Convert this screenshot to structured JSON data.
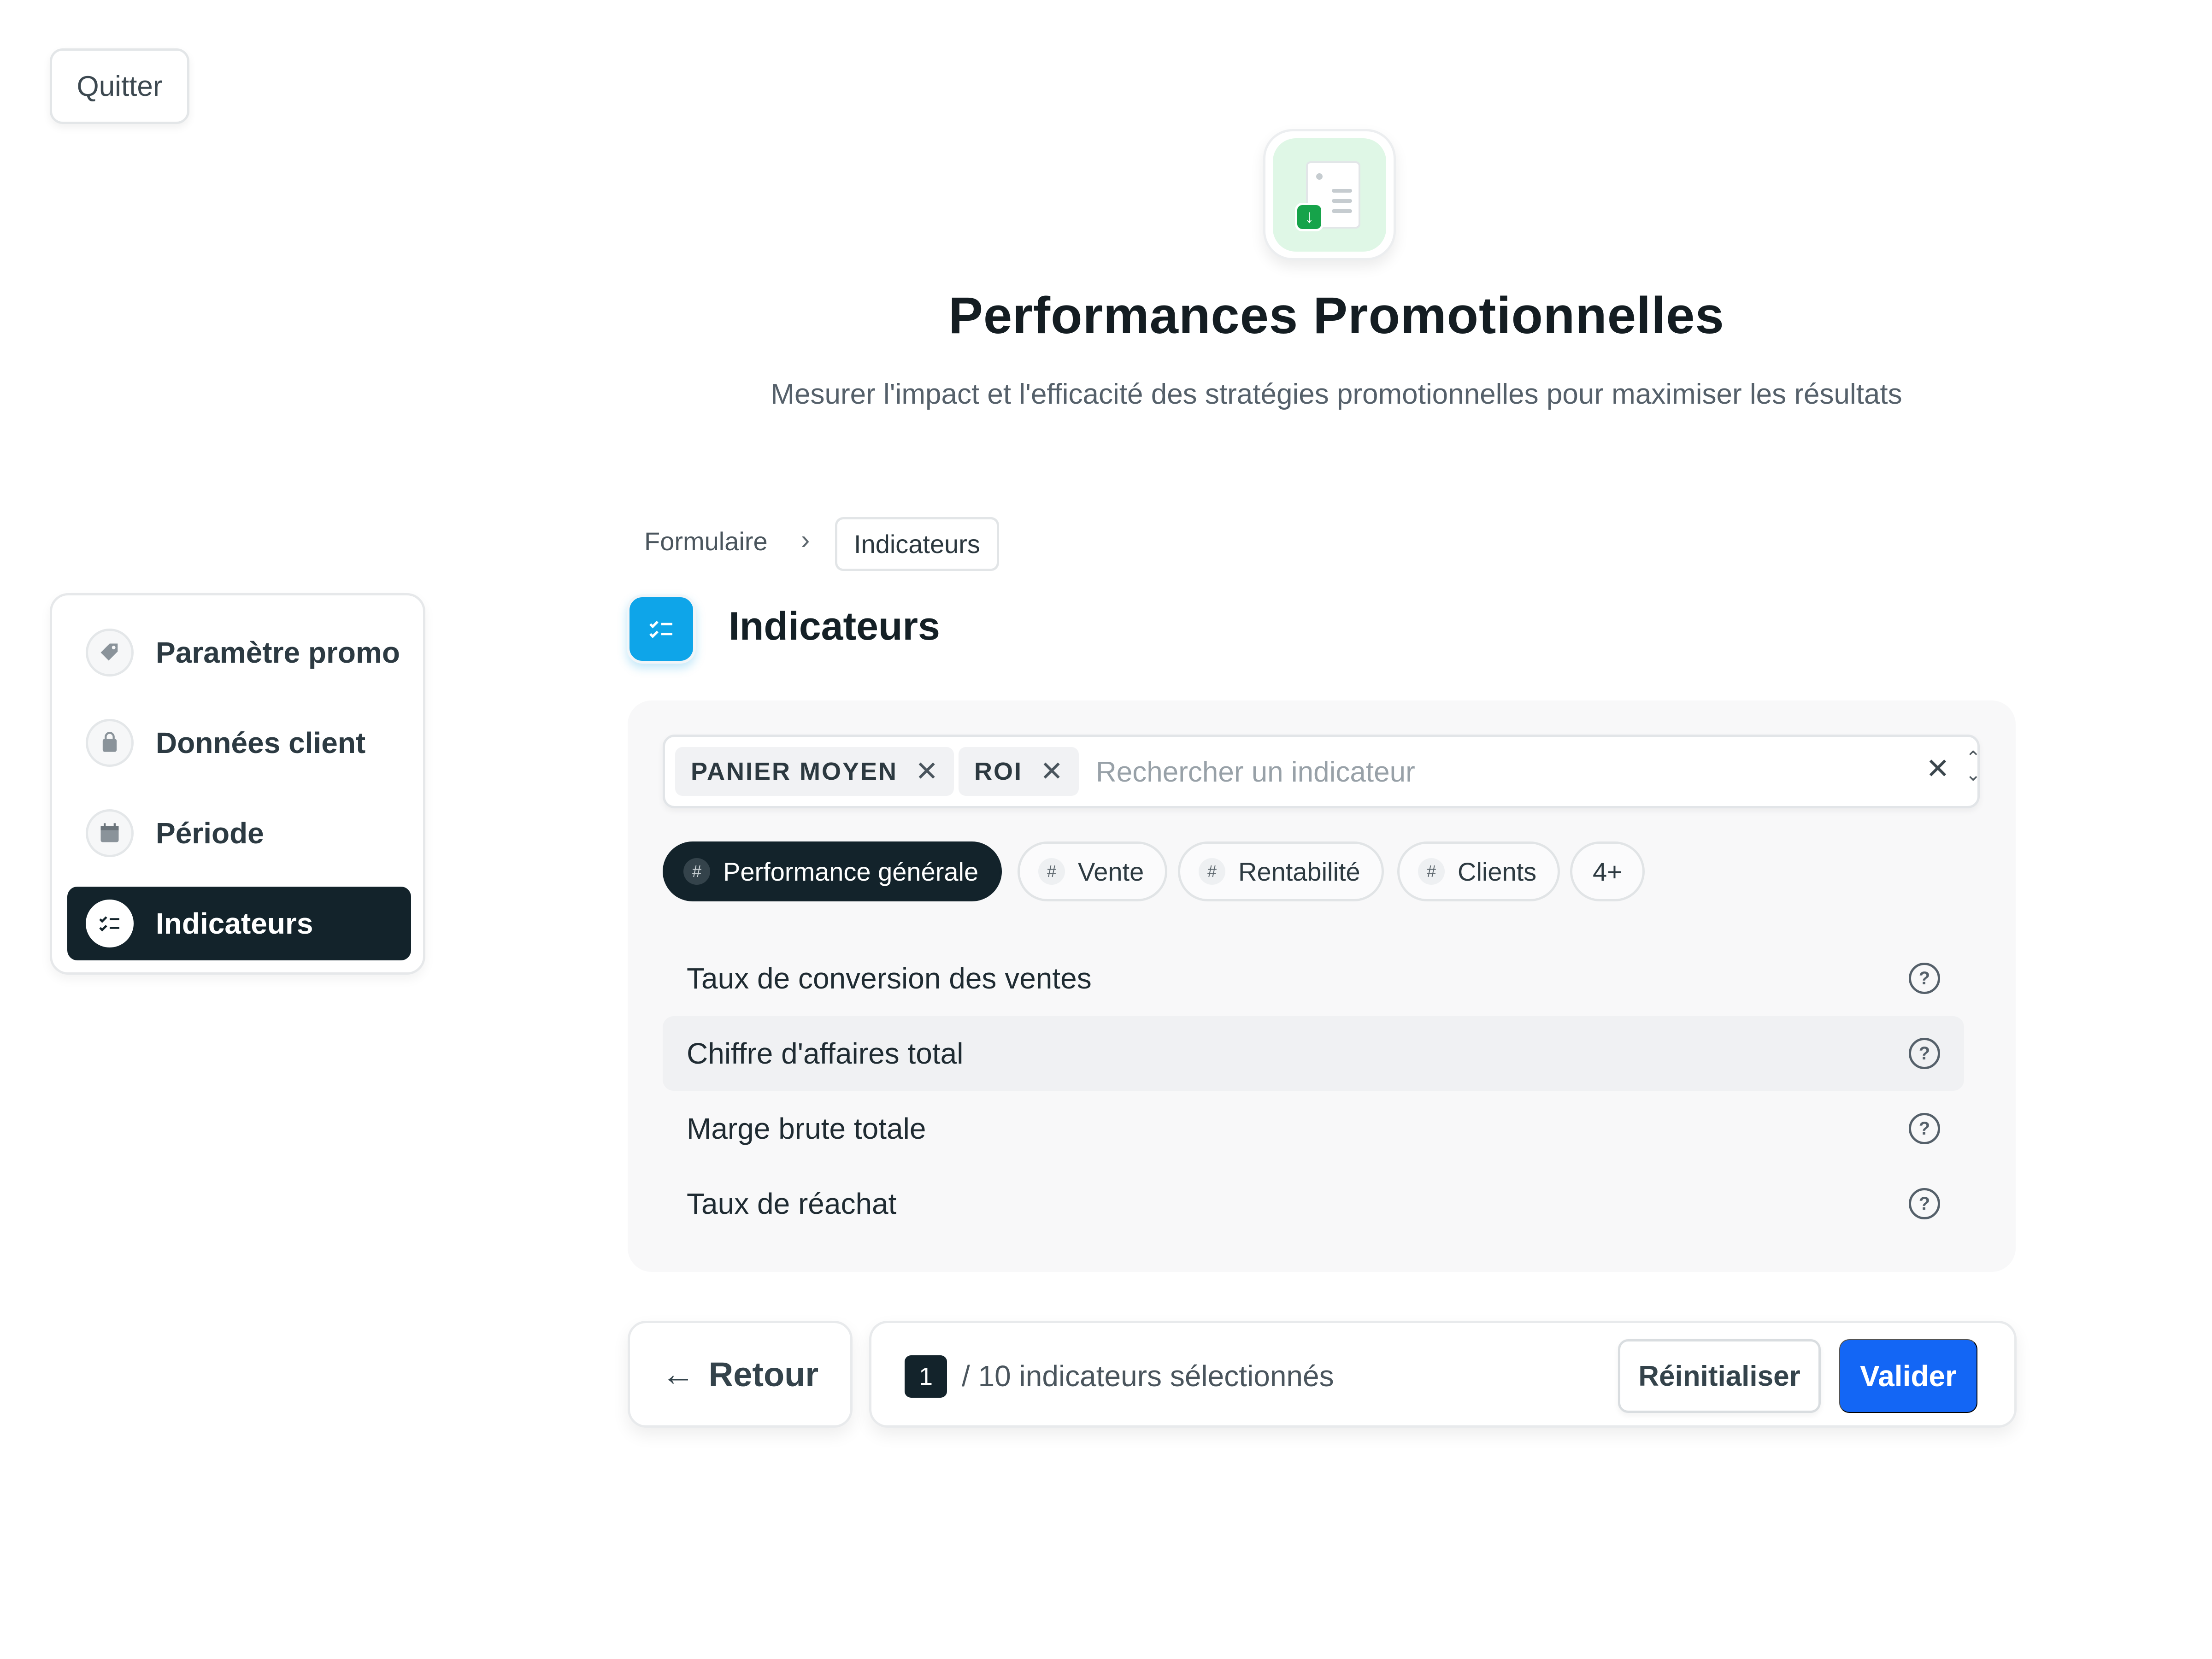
{
  "app": {
    "quit_label": "Quitter"
  },
  "header": {
    "icon": "document-download-icon",
    "title": "Performances Promotionnelles",
    "subtitle": "Mesurer l'impact et l'efficacité des stratégies promotionnelles pour maximiser les résultats"
  },
  "sidebar": {
    "items": [
      {
        "label": "Paramètre promo",
        "icon": "tag-icon",
        "active": false
      },
      {
        "label": "Données client",
        "icon": "shopping-bag-icon",
        "active": false
      },
      {
        "label": "Période",
        "icon": "calendar-icon",
        "active": false
      },
      {
        "label": "Indicateurs",
        "icon": "checklist-icon",
        "active": true
      }
    ]
  },
  "breadcrumb": {
    "items": [
      "Formulaire",
      "Indicateurs"
    ],
    "separator": ">"
  },
  "section": {
    "title": "Indicateurs",
    "icon": "checklist-icon",
    "accent_color": "#0ea5e9"
  },
  "search": {
    "selected_chips": [
      "PANIER MOYEN",
      "ROI"
    ],
    "value": "",
    "placeholder": "Rechercher un indicateur"
  },
  "categories": [
    {
      "label": "Performance générale",
      "active": true
    },
    {
      "label": "Vente",
      "active": false
    },
    {
      "label": "Rentabilité",
      "active": false
    },
    {
      "label": "Clients",
      "active": false
    }
  ],
  "categories_more": "4+",
  "indicators": [
    {
      "label": "Taux de conversion des ventes",
      "hover": false
    },
    {
      "label": "Chiffre d'affaires total",
      "hover": true
    },
    {
      "label": "Marge brute totale",
      "hover": false
    },
    {
      "label": "Taux de réachat",
      "hover": false
    }
  ],
  "footer": {
    "back_label": "Retour",
    "selected_count": "1",
    "selected_text": "/ 10 indicateurs sélectionnés",
    "reset_label": "Réinitialiser",
    "validate_label": "Valider",
    "primary_color": "#1366f5",
    "dark_color": "#13232b"
  }
}
